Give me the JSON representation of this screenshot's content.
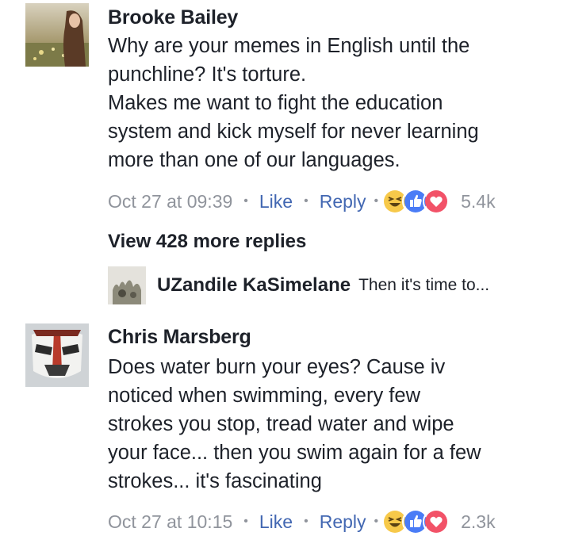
{
  "comments": [
    {
      "author": "Brooke Bailey",
      "lines": [
        "Why are your memes in English until the",
        "punchline? It's torture.",
        "Makes me want to fight the education",
        "system and kick myself for never learning",
        "more than one of our languages."
      ],
      "time": "Oct 27 at 09:39",
      "like_label": "Like",
      "reply_label": "Reply",
      "reaction_count": "5.4k",
      "reactions": [
        "haha-icon",
        "like-icon",
        "love-icon"
      ],
      "view_more": "View 428 more replies",
      "reply_preview": {
        "author": "UZandile KaSimelane",
        "text": "Then it's time to..."
      }
    },
    {
      "author": "Chris Marsberg",
      "lines": [
        "Does water burn your eyes? Cause iv",
        "noticed when swimming, every few",
        "strokes you stop, tread water and wipe",
        "your face... then you swim again for a few",
        "strokes... it's fascinating"
      ],
      "time": "Oct 27 at 10:15",
      "like_label": "Like",
      "reply_label": "Reply",
      "reaction_count": "2.3k",
      "reactions": [
        "haha-icon",
        "like-icon",
        "love-icon"
      ]
    }
  ],
  "colors": {
    "link": "#4267b2",
    "meta": "#90949c",
    "text": "#1d2129",
    "haha": "#f7c94a",
    "like": "#4a7cf6",
    "love": "#f25268"
  }
}
